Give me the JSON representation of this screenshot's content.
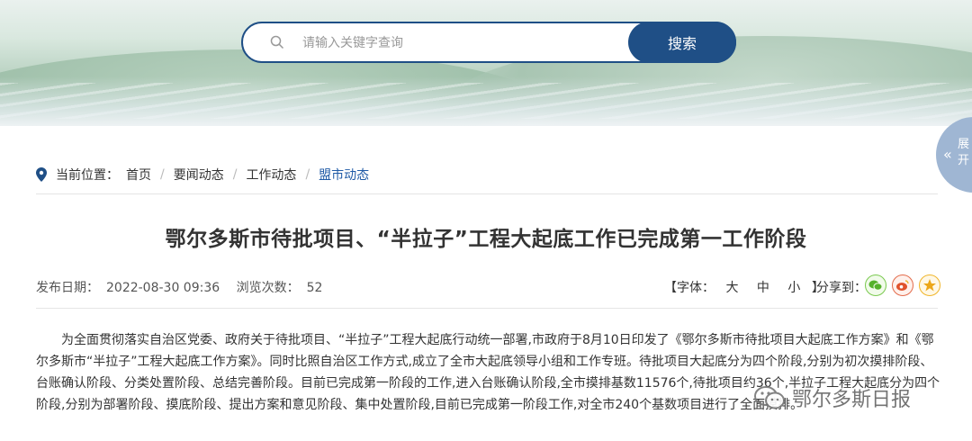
{
  "search": {
    "placeholder": "请输入关键字查询",
    "button_label": "搜索"
  },
  "side_tab": {
    "chevron": "«",
    "label": "展开"
  },
  "breadcrumb": {
    "prefix": "当前位置：",
    "items": [
      "首页",
      "要闻动态",
      "工作动态",
      "盟市动态"
    ]
  },
  "article": {
    "title": "鄂尔多斯市待批项目、“半拉子”工程大起底工作已完成第一工作阶段",
    "publish_label": "发布日期：",
    "publish_date": "2022-08-30 09:36",
    "views_label": "浏览次数：",
    "views": "52",
    "font_label": "【字体：",
    "font_sizes": [
      "大",
      "中",
      "小"
    ],
    "font_close": "】",
    "share_label": "分享到：",
    "body": "为全面贯彻落实自治区党委、政府关于待批项目、“半拉子”工程大起底行动统一部署,市政府于8月10日印发了《鄂尔多斯市待批项目大起底工作方案》和《鄂尔多斯市“半拉子”工程大起底工作方案》。同时比照自治区工作方式,成立了全市大起底领导小组和工作专班。待批项目大起底分为四个阶段,分别为初次摸排阶段、台账确认阶段、分类处置阶段、总结完善阶段。目前已完成第一阶段的工作,进入台账确认阶段,全市摸排基数11576个,待批项目约36个,半拉子工程大起底分为四个阶段,分别为部署阶段、摸底阶段、提出方案和意见阶段、集中处置阶段,目前已完成第一阶段工作,对全市240个基数项目进行了全面摸排。"
  },
  "watermark": {
    "text": "鄂尔多斯日报"
  },
  "colors": {
    "primary": "#1f4f86",
    "link_active": "#1f5aa6",
    "tab": "#9fb6d3"
  }
}
